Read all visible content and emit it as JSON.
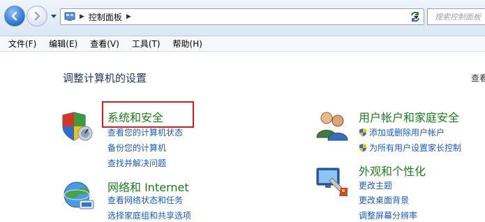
{
  "addressbar": {
    "breadcrumb": [
      "控制面板"
    ],
    "search_placeholder": "搜索控制面板"
  },
  "menubar": {
    "items": [
      "文件(F)",
      "编辑(E)",
      "查看(V)",
      "工具(T)",
      "帮助(H)"
    ]
  },
  "main": {
    "title": "调整计算机的设置",
    "view_by": "查看",
    "categories": [
      {
        "title": "系统和安全",
        "icon": "shield-icon",
        "links": [
          "查看您的计算机状态",
          "备份您的计算机",
          "查找并解决问题"
        ]
      },
      {
        "title": "网络和 Internet",
        "icon": "network-globe-icon",
        "links": [
          "查看网络状态和任务",
          "选择家庭组和共享选项"
        ]
      },
      {
        "title": "用户帐户和家庭安全",
        "icon": "users-icon",
        "links": [
          "添加或删除用户帐户",
          "为所有用户设置家长控制"
        ]
      },
      {
        "title": "外观和个性化",
        "icon": "appearance-icon",
        "links": [
          "更改主题",
          "更改桌面背景",
          "调整屏幕分辨率"
        ]
      }
    ]
  },
  "colors": {
    "category_title": "#1e7a1e",
    "link": "#1e5bb8",
    "highlight": "#e01b1b"
  }
}
